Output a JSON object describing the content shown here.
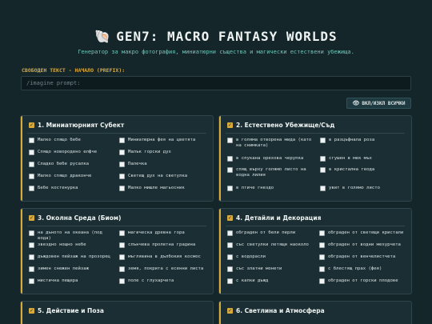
{
  "header": {
    "title": "GEN7: MACRO FANTASY WORLDS",
    "subtitle": "Генератор за макро фотография, миниатюрни същества и магически естествени убежища."
  },
  "prefix": {
    "label": "СВОБОДЕН ТЕКСТ - НАЧАЛО (PREFIX):",
    "placeholder": "/imagine prompt:",
    "value": ""
  },
  "toggle_all_label": "ВКЛ/ИЗКЛ ВСИЧКИ",
  "accent_color": "#d9a93a",
  "sections": [
    {
      "title": "1. Миниатюрният Субект",
      "options": [
        "Малко спящо бебе",
        "Миниатюрна фея на цветята",
        "Спящо новородено елфче",
        "Малък горски дух",
        "Сладко бебе русалка",
        "Палечка",
        "Малко спящо драконче",
        "Светещ дух на светулка",
        "Бебе костенурка",
        "Малко мишле магьосник"
      ]
    },
    {
      "title": "2. Естествено Убежище/Съд",
      "options": [
        "в голяма отворена мида (като на снимката)",
        "в разцъфнала роза",
        "в спукана орехова черупка",
        "сгушен в мек мъх",
        "спящ върху голямо листо на водна лилия",
        "в кристална геода",
        "в птиче гнездо",
        "увит в голямо листо"
      ]
    },
    {
      "title": "3. Околна Среда (Биом)",
      "options": [
        "на дъното на океана (под вода)",
        "магическа древна гора",
        "звездно нощно небе",
        "слънчева пролетна градина",
        "дъждовен пейзаж на прозорец",
        "мъглявина в дълбокия космос",
        "зимен снежен пейзаж",
        "земя, покрита с есенни листа",
        "мистична пещера",
        "поле с глухарчета"
      ]
    },
    {
      "title": "4. Детайли и Декорация",
      "options": [
        "обграден от бели перли",
        "обграден от светещи кристали",
        "със светулки летящи наоколо",
        "обграден от водни мехурчета",
        "с водорасли",
        "обграден от венчелистчета",
        "със златни монети",
        "с блестящ прах (фея)",
        "с капки дъжд",
        "обграден от горски плодове"
      ]
    },
    {
      "title": "5. Действие и Поза",
      "options": []
    },
    {
      "title": "6. Светлина и Атмосфера",
      "options": []
    }
  ]
}
